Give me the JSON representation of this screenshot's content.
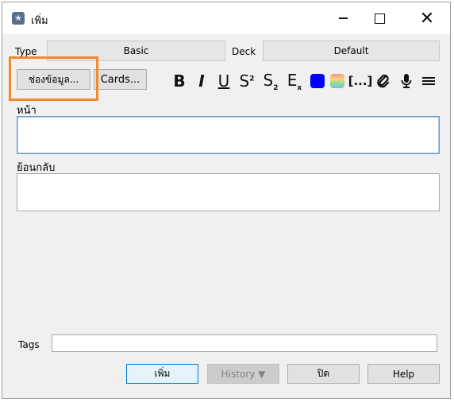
{
  "window": {
    "title": "เพิ่ม"
  },
  "chooser": {
    "type_label": "Type",
    "type_value": "Basic",
    "deck_label": "Deck",
    "deck_value": "Default"
  },
  "toolbar": {
    "fields_button": "ช่องข้อมูล...",
    "cards_button": "Cards...",
    "bold": "B",
    "italic": "I",
    "underline": "U",
    "superscript_base": "S",
    "superscript_mark": "2",
    "subscript_base": "S",
    "subscript_mark": "2",
    "clear_base": "E",
    "clear_mark": "x",
    "cloze": "[...]",
    "text_color": "#0000ff"
  },
  "fields": [
    {
      "label": "หน้า",
      "value": ""
    },
    {
      "label": "ย้อนกลับ",
      "value": ""
    }
  ],
  "tags": {
    "label": "Tags",
    "value": ""
  },
  "buttons": {
    "add": "เพิ่ม",
    "history": "History ▼",
    "close": "ปิด",
    "help": "Help"
  }
}
